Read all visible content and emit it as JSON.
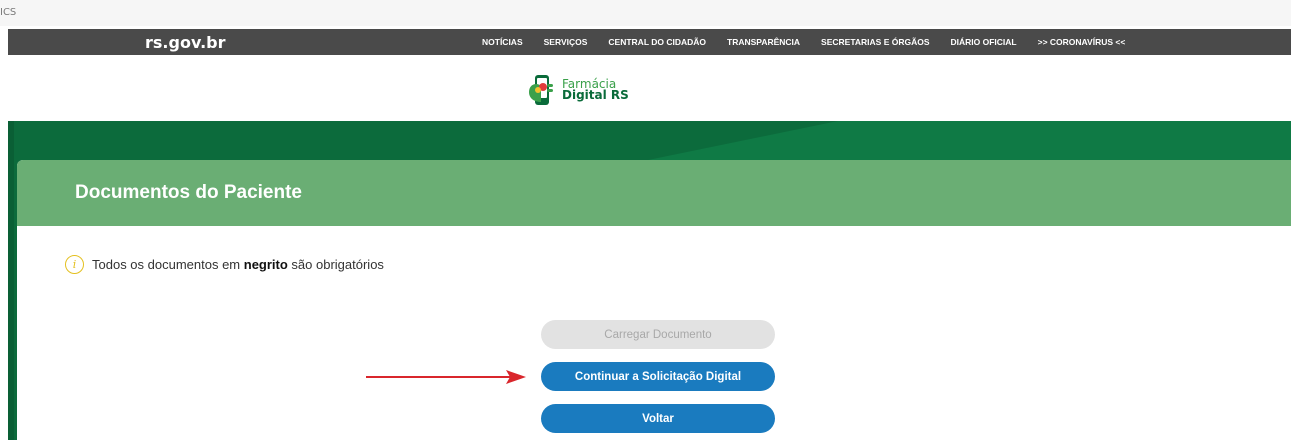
{
  "browser": {
    "tab_fragment": "ICS"
  },
  "gov_bar": {
    "logo": "rs.gov.br",
    "nav": [
      {
        "label": "NOTÍCIAS"
      },
      {
        "label": "SERVIÇOS"
      },
      {
        "label": "CENTRAL DO CIDADÃO"
      },
      {
        "label": "TRANSPARÊNCIA"
      },
      {
        "label": "SECRETARIAS E ÓRGÃOS"
      },
      {
        "label": "DIÁRIO OFICIAL"
      },
      {
        "label": ">> CORONAVÍRUS <<"
      }
    ]
  },
  "brand": {
    "line1": "Farmácia",
    "line2": "Digital RS",
    "logo_icon": "farmacia-digital-logo"
  },
  "card": {
    "title": "Documentos do Paciente",
    "notice": {
      "icon": "info-icon",
      "before": "Todos os documentos em ",
      "bold": "negrito",
      "after": " são obrigatórios"
    }
  },
  "buttons": {
    "upload": "Carregar Documento",
    "continue": "Continuar a Solicitação Digital",
    "back": "Voltar"
  },
  "annotation": {
    "icon": "red-arrow-right",
    "color": "#d9262c"
  },
  "colors": {
    "gov_bar": "#4a4a4a",
    "hero_green": "#0c6b3c",
    "header_green": "#6aae74",
    "button_blue": "#1a7bbf",
    "button_disabled": "#e2e2e2",
    "info_yellow": "#e4c020"
  }
}
